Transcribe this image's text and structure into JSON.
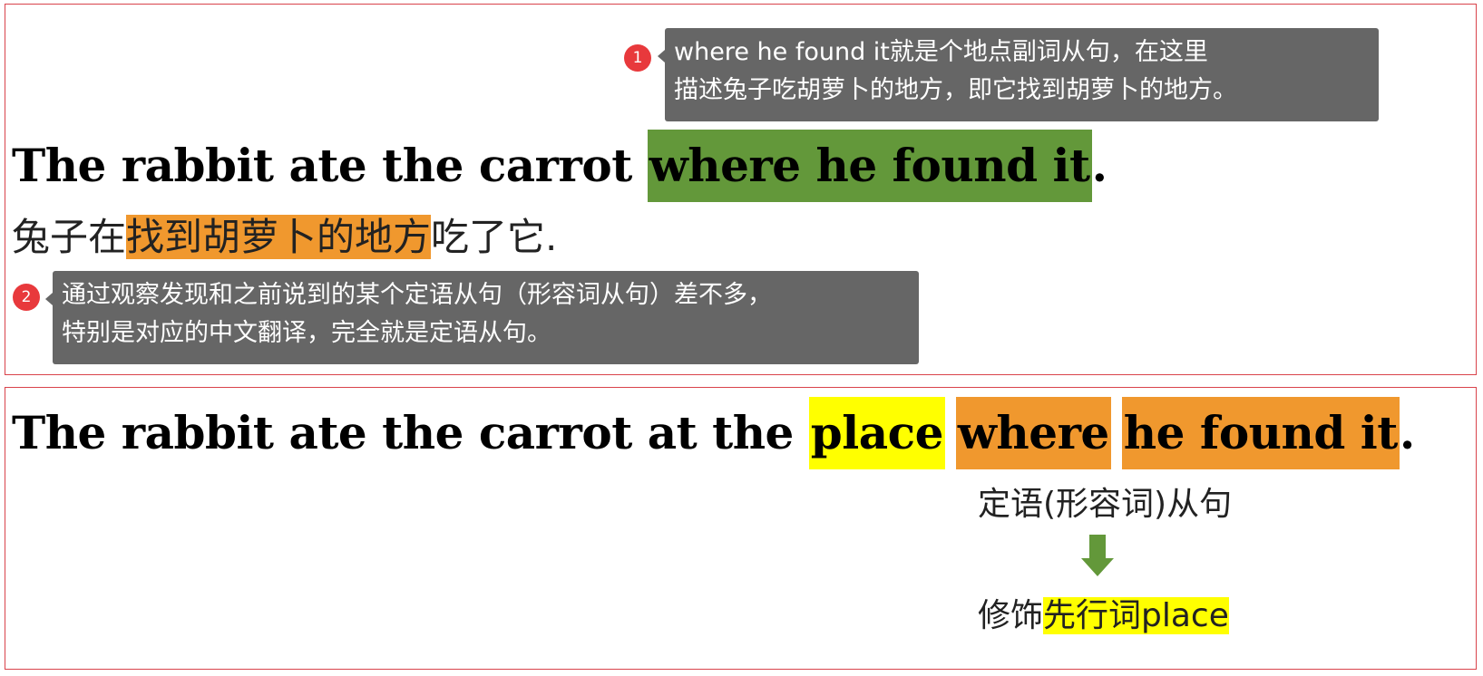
{
  "colors": {
    "green_highlight": "#63983a",
    "orange_highlight": "#f0982e",
    "yellow_highlight": "#ffff00",
    "note_bg": "#666666",
    "badge": "#e8393c",
    "border": "#d9434b"
  },
  "top": {
    "note1": {
      "badge": "1",
      "line1": "where he found it就是个地点副词从句，在这里",
      "line2": "描述兔子吃胡萝卜的地方，即它找到胡萝卜的地方。"
    },
    "sentence": {
      "prefix": "The rabbit ate the carrot ",
      "highlight": "where he found it",
      "suffix": "."
    },
    "translation": {
      "prefix": "兔子在",
      "highlight": "找到胡萝卜的地方",
      "suffix": "吃了它."
    },
    "note2": {
      "badge": "2",
      "line1": "通过观察发现和之前说到的某个定语从句（形容词从句）差不多，",
      "line2": "特别是对应的中文翻译，完全就是定语从句。"
    }
  },
  "bottom": {
    "sentence": {
      "prefix": "The rabbit ate the carrot at the ",
      "place": "place",
      "where": "where",
      "rest": "he found it",
      "suffix": "."
    },
    "clause_label": "定语(形容词)从句",
    "arrow_icon": "down-arrow",
    "modifies_prefix": "修饰",
    "modifies_highlight": "先行词place"
  }
}
